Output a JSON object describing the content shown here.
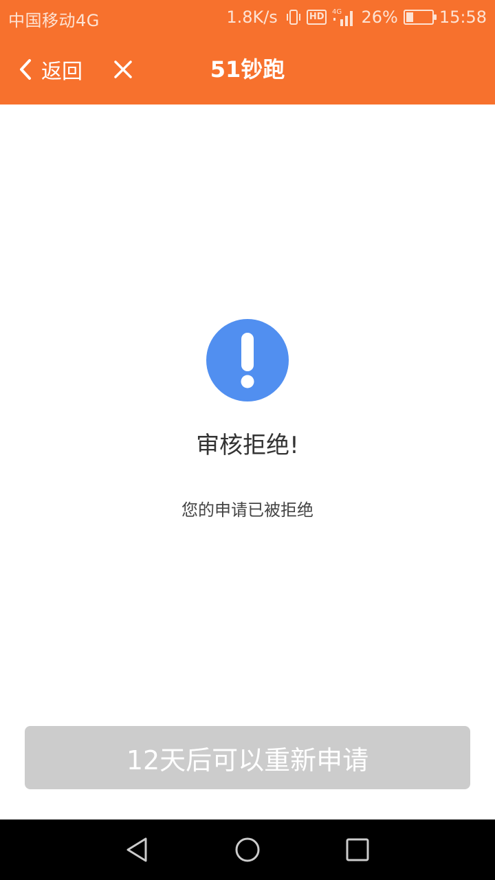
{
  "status_bar": {
    "carrier": "中国移动4G",
    "speed": "1.8K/s",
    "hd": "HD",
    "network": "4G",
    "battery": "26%",
    "time": "15:58"
  },
  "nav": {
    "back_label": "返回",
    "title": "51钞跑"
  },
  "result": {
    "title": "审核拒绝!",
    "description": "您的申请已被拒绝"
  },
  "action": {
    "button_label": "12天后可以重新申请"
  },
  "colors": {
    "accent": "#f7712d",
    "alert_icon": "#518ff0",
    "button_disabled": "#cccccc"
  },
  "icons": {
    "back": "chevron-left-icon",
    "close": "close-icon",
    "alert": "exclamation-circle-icon",
    "sys_back": "triangle-back-icon",
    "sys_home": "circle-home-icon",
    "sys_recent": "square-recent-icon"
  }
}
